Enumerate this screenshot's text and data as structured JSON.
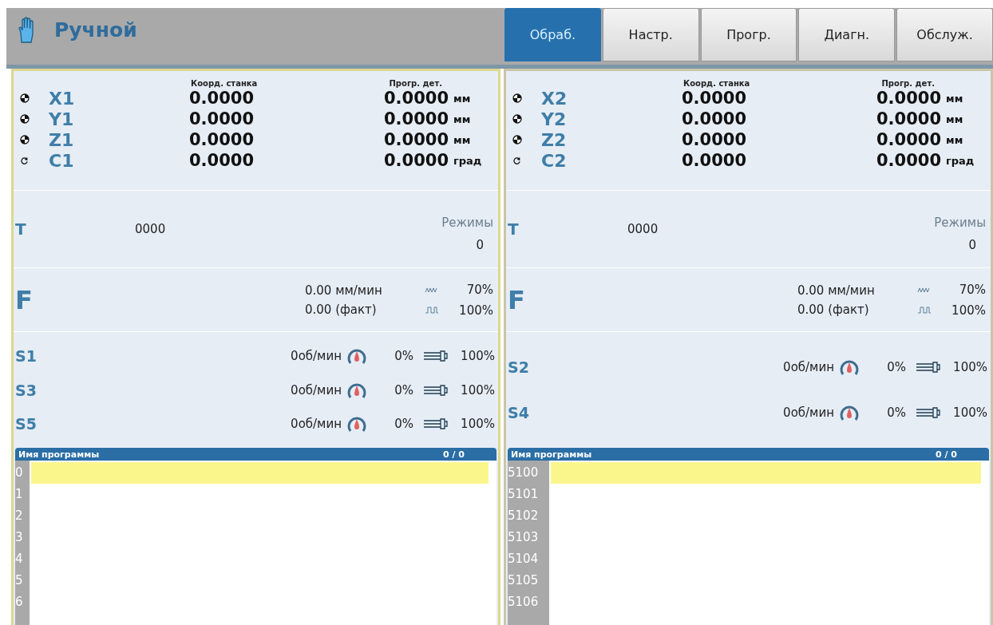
{
  "mode": {
    "label": "Ручной"
  },
  "tabs": [
    {
      "label": "Обраб.",
      "selected": true
    },
    {
      "label": "Настр.",
      "selected": false
    },
    {
      "label": "Прогр.",
      "selected": false
    },
    {
      "label": "Диагн.",
      "selected": false
    },
    {
      "label": "Обслуж.",
      "selected": false
    }
  ],
  "channels": [
    {
      "active": true,
      "headers": {
        "machine": "Коорд. станка",
        "program": "Прогр. дет."
      },
      "axes": [
        {
          "name": "X1",
          "kind": "linear",
          "machine": "0.0000",
          "program": "0.0000",
          "unit": "мм"
        },
        {
          "name": "Y1",
          "kind": "linear",
          "machine": "0.0000",
          "program": "0.0000",
          "unit": "мм"
        },
        {
          "name": "Z1",
          "kind": "linear",
          "machine": "0.0000",
          "program": "0.0000",
          "unit": "мм"
        },
        {
          "name": "C1",
          "kind": "rotary",
          "machine": "0.0000",
          "program": "0.0000",
          "unit": "град"
        }
      ],
      "tool": {
        "label": "T",
        "value": "0000",
        "modes_label": "Режимы",
        "modes_value": "0"
      },
      "feed": {
        "label": "F",
        "rate": "0.00 мм/мин",
        "actual": "0.00 (факт)",
        "rapid_override": "70%",
        "feed_override": "100%"
      },
      "spindles": [
        {
          "name": "S1",
          "speed": "0об/мин",
          "load": "0%",
          "override": "100%"
        },
        {
          "name": "S3",
          "speed": "0об/мин",
          "load": "0%",
          "override": "100%"
        },
        {
          "name": "S5",
          "speed": "0об/мин",
          "load": "0%",
          "override": "100%"
        }
      ],
      "program": {
        "title": "Имя программы",
        "count": "0 / 0",
        "lines": [
          {
            "number": "0",
            "selected": true
          },
          {
            "number": "1",
            "selected": false
          },
          {
            "number": "2",
            "selected": false
          },
          {
            "number": "3",
            "selected": false
          },
          {
            "number": "4",
            "selected": false
          },
          {
            "number": "5",
            "selected": false
          },
          {
            "number": "6",
            "selected": false
          }
        ]
      }
    },
    {
      "active": false,
      "headers": {
        "machine": "Коорд. станка",
        "program": "Прогр. дет."
      },
      "axes": [
        {
          "name": "X2",
          "kind": "linear",
          "machine": "0.0000",
          "program": "0.0000",
          "unit": "мм"
        },
        {
          "name": "Y2",
          "kind": "linear",
          "machine": "0.0000",
          "program": "0.0000",
          "unit": "мм"
        },
        {
          "name": "Z2",
          "kind": "linear",
          "machine": "0.0000",
          "program": "0.0000",
          "unit": "мм"
        },
        {
          "name": "C2",
          "kind": "rotary",
          "machine": "0.0000",
          "program": "0.0000",
          "unit": "град"
        }
      ],
      "tool": {
        "label": "T",
        "value": "0000",
        "modes_label": "Режимы",
        "modes_value": "0"
      },
      "feed": {
        "label": "F",
        "rate": "0.00 мм/мин",
        "actual": "0.00 (факт)",
        "rapid_override": "70%",
        "feed_override": "100%"
      },
      "spindles": [
        {
          "name": "S2",
          "speed": "0об/мин",
          "load": "0%",
          "override": "100%"
        },
        {
          "name": "S4",
          "speed": "0об/мин",
          "load": "0%",
          "override": "100%"
        }
      ],
      "program": {
        "title": "Имя программы",
        "count": "0 / 0",
        "lines": [
          {
            "number": "5100",
            "selected": true
          },
          {
            "number": "5101",
            "selected": false
          },
          {
            "number": "5102",
            "selected": false
          },
          {
            "number": "5103",
            "selected": false
          },
          {
            "number": "5104",
            "selected": false
          },
          {
            "number": "5105",
            "selected": false
          },
          {
            "number": "5106",
            "selected": false
          }
        ]
      }
    }
  ]
}
